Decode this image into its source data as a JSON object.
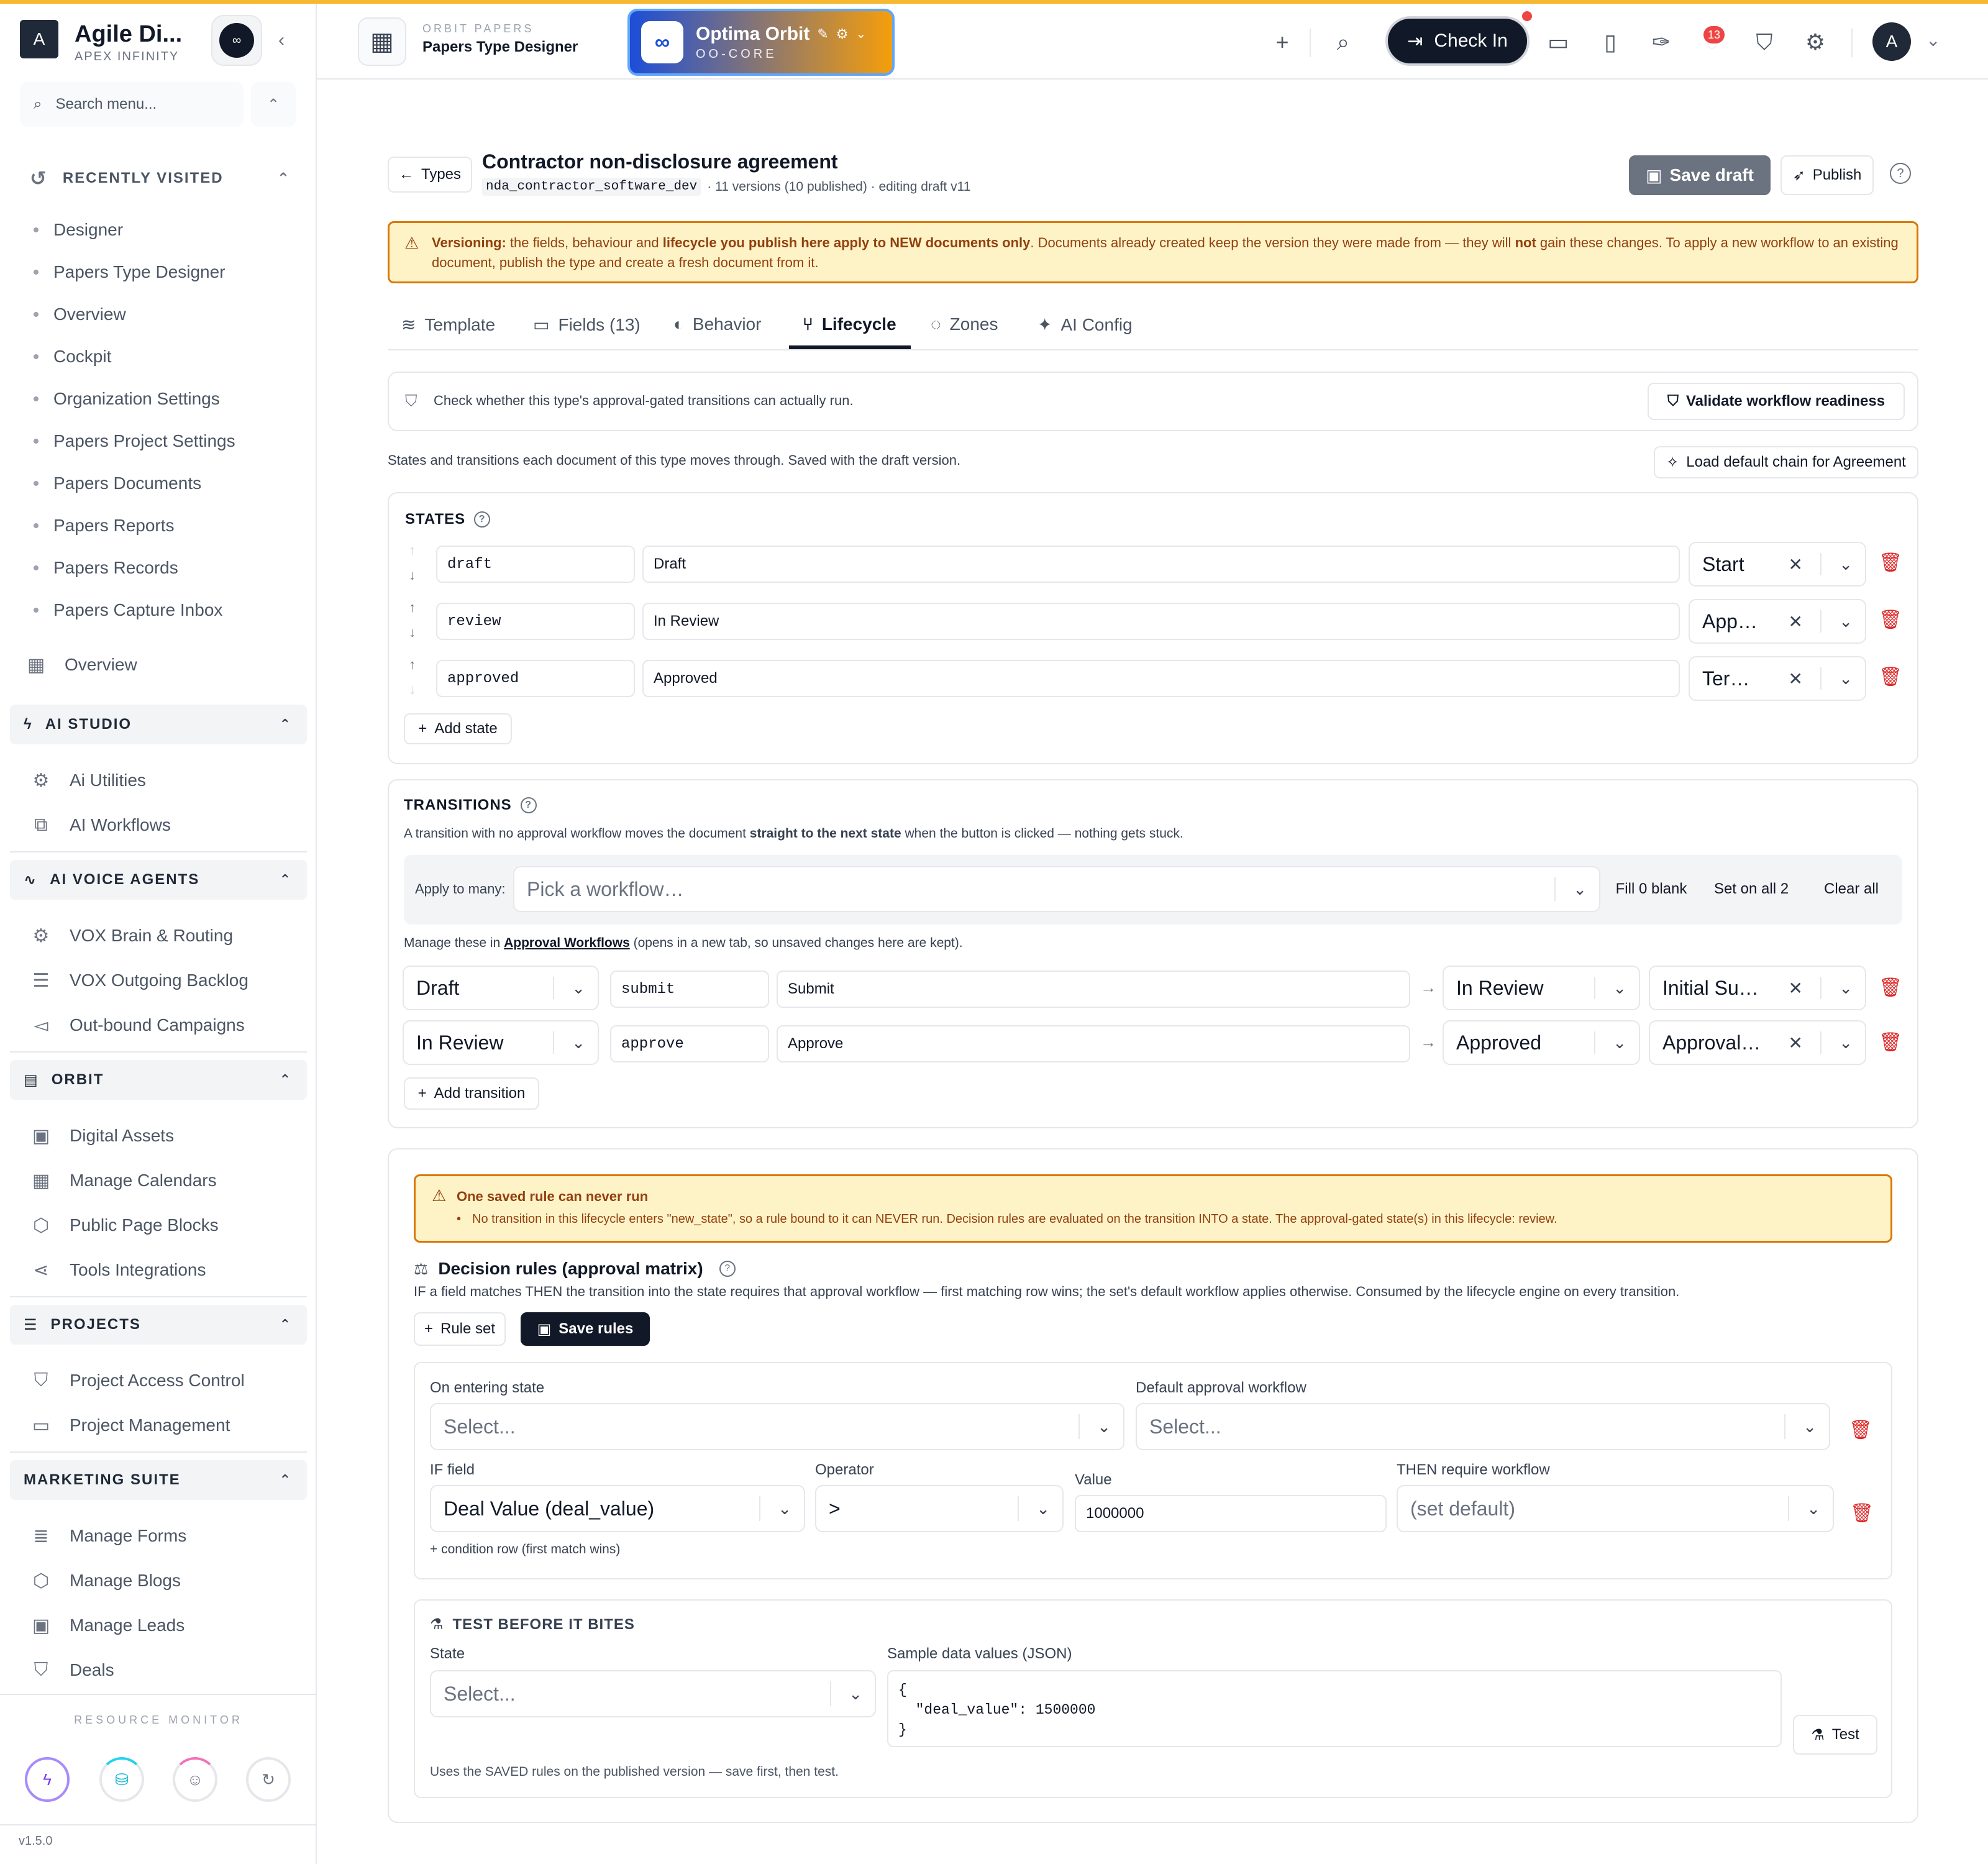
{
  "brand": {
    "initial": "A",
    "name": "Agile Di...",
    "sub": "APEX INFINITY",
    "logo_icon": "infinity-logo"
  },
  "sidebar": {
    "search_placeholder": "Search menu...",
    "recent_title": "RECENTLY VISITED",
    "recent": [
      "Designer",
      "Papers Type Designer",
      "Overview",
      "Cockpit",
      "Organization Settings",
      "Papers Project Settings",
      "Papers Documents",
      "Papers Reports",
      "Papers Records",
      "Papers Capture Inbox"
    ],
    "overview": "Overview",
    "sections": [
      {
        "title": "AI STUDIO",
        "items": [
          "Ai Utilities",
          "AI Workflows"
        ]
      },
      {
        "title": "AI VOICE AGENTS",
        "items": [
          "VOX Brain & Routing",
          "VOX Outgoing Backlog",
          "Out-bound Campaigns"
        ]
      },
      {
        "title": "ORBIT",
        "items": [
          "Digital Assets",
          "Manage Calendars",
          "Public Page Blocks",
          "Tools Integrations"
        ]
      },
      {
        "title": "PROJECTS",
        "items": [
          "Project Access Control",
          "Project Management"
        ]
      },
      {
        "title": "MARKETING SUITE",
        "items": [
          "Manage Forms",
          "Manage Blogs",
          "Manage Leads",
          "Deals"
        ]
      }
    ],
    "resource_monitor": "RESOURCE MONITOR",
    "version": "v1.5.0"
  },
  "topbar": {
    "crumb_small": "ORBIT PAPERS",
    "crumb_title": "Papers Type Designer",
    "orbit_name": "Optima Orbit",
    "orbit_code": "OO-CORE",
    "checkin": "Check In",
    "notif_count": "13",
    "avatar": "A"
  },
  "header": {
    "back": "Types",
    "title": "Contractor non-disclosure agreement",
    "slug": "nda_contractor_software_dev",
    "meta": "· 11 versions (10 published) · editing draft v11",
    "save_draft": "Save draft",
    "publish": "Publish"
  },
  "banner": {
    "p1": "Versioning:",
    "p2": " the fields, behaviour and ",
    "p3": "lifecycle you publish here apply to NEW documents only",
    "p4": ". Documents already created keep the version they were made from — they will ",
    "p5": "not",
    "p6": " gain these changes. To apply a new workflow to an existing document, publish the type and create a fresh document from it."
  },
  "tabs": [
    "Template",
    "Fields (13)",
    "Behavior",
    "Lifecycle",
    "Zones",
    "AI Config"
  ],
  "validate": {
    "text": "Check whether this type's approval-gated transitions can actually run.",
    "button": "Validate workflow readiness"
  },
  "states_intro": "States and transitions each document of this type moves through. Saved with the draft version.",
  "load_default": "Load default chain for Agreement",
  "states": {
    "title": "STATES",
    "rows": [
      {
        "key": "draft",
        "label": "Draft",
        "kind": "Start"
      },
      {
        "key": "review",
        "label": "In Review",
        "kind": "App…"
      },
      {
        "key": "approved",
        "label": "Approved",
        "kind": "Ter…"
      }
    ],
    "add": "Add state"
  },
  "transitions": {
    "title": "TRANSITIONS",
    "d1": "A transition with no approval workflow moves the document ",
    "d2": "straight to the next state",
    "d3": " when the button is clicked — nothing gets stuck.",
    "apply_label": "Apply to many:",
    "apply_placeholder": "Pick a workflow…",
    "fill_blank": "Fill 0 blank",
    "set_all": "Set on all 2",
    "clear_all": "Clear all",
    "manage1": "Manage these in ",
    "manage_link": "Approval Workflows",
    "manage2": " (opens in a new tab, so unsaved changes here are kept).",
    "rows": [
      {
        "from": "Draft",
        "key": "submit",
        "label": "Submit",
        "to": "In Review",
        "workflow": "Initial Su…"
      },
      {
        "from": "In Review",
        "key": "approve",
        "label": "Approve",
        "to": "Approved",
        "workflow": "Approval…"
      }
    ],
    "add": "Add transition"
  },
  "warning": {
    "title": "One saved rule can never run",
    "text": "No transition in this lifecycle enters \"new_state\", so a rule bound to it can NEVER run. Decision rules are evaluated on the transition INTO a state. The approval-gated state(s) in this lifecycle: review."
  },
  "rules": {
    "title": "Decision rules (approval matrix)",
    "desc": "IF a field matches THEN the transition into the state requires that approval workflow — first matching row wins; the set's default workflow applies otherwise. Consumed by the lifecycle engine on every transition.",
    "rule_set": "Rule set",
    "save": "Save rules",
    "on_entering": "On entering state",
    "default_wf": "Default approval workflow",
    "select_ph": "Select...",
    "if_field": "IF field",
    "operator": "Operator",
    "value": "Value",
    "then": "THEN require workflow",
    "field_val": "Deal Value (deal_value)",
    "op_val": ">",
    "value_val": "1000000",
    "then_val": "(set default)",
    "add_cond": "+ condition row (first match wins)"
  },
  "test": {
    "title": "TEST BEFORE IT BITES",
    "state": "State",
    "sample": "Sample data values (JSON)",
    "state_ph": "Select...",
    "json_l1": "{",
    "json_l2": "  \"deal_value\": 1500000",
    "json_l3": "}",
    "button": "Test",
    "note": "Uses the SAVED rules on the published version — save first, then test."
  },
  "colors": {
    "accent": "#f5b82e",
    "danger": "#dc2626",
    "dark": "#111827",
    "warn_bg": "#fef3c7",
    "warn_border": "#d97706",
    "warn_text": "#92400e"
  }
}
